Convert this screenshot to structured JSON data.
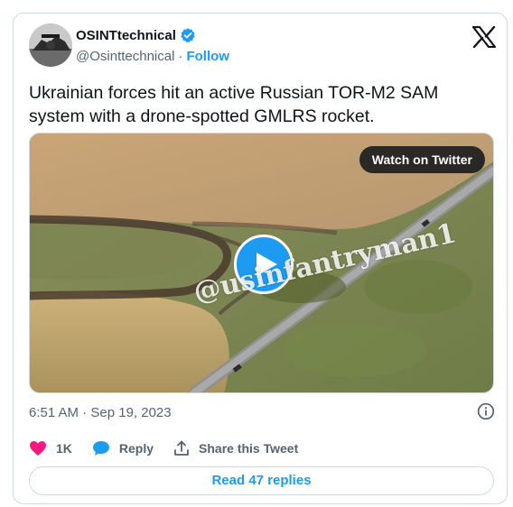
{
  "author": {
    "name": "OSINTtechnical",
    "handle": "@Osinttechnical",
    "separator": "·",
    "follow_label": "Follow"
  },
  "tweet": {
    "text": "Ukrainian forces hit an active Russian TOR-M2 SAM system with a drone-spotted GMLRS rocket."
  },
  "media": {
    "watch_label": "Watch on Twitter",
    "watermark": "@usinfantryman1"
  },
  "meta": {
    "timestamp": "6:51 AM · Sep 19, 2023"
  },
  "actions": {
    "likes": "1K",
    "reply_label": "Reply",
    "share_label": "Share this Tweet"
  },
  "footer": {
    "read_replies": "Read 47 replies"
  },
  "colors": {
    "accent": "#1d9bf0",
    "like": "#f91880",
    "text_secondary": "#536471"
  },
  "icons": [
    "verified-badge-icon",
    "x-logo-icon",
    "play-icon",
    "info-icon",
    "heart-icon",
    "reply-bubble-icon",
    "share-upload-icon"
  ]
}
